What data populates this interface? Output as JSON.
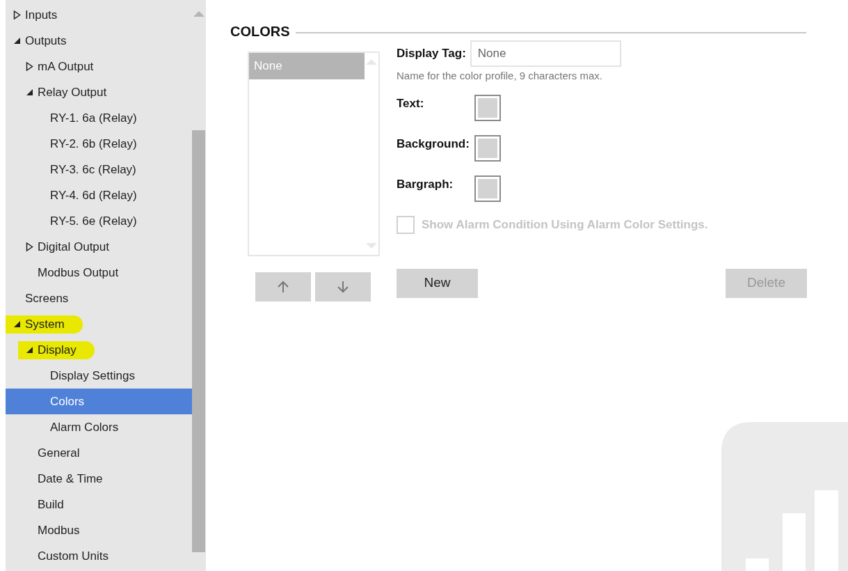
{
  "tree": [
    {
      "label": "Inputs",
      "expanded": false,
      "selected": false,
      "highlighted": false
    },
    {
      "label": "Outputs",
      "expanded": true,
      "selected": false,
      "highlighted": false,
      "children": [
        {
          "label": "mA Output",
          "expanded": false,
          "selected": false,
          "highlighted": false
        },
        {
          "label": "Relay Output",
          "expanded": true,
          "selected": false,
          "highlighted": false,
          "children": [
            {
              "label": "RY-1. 6a (Relay)",
              "selected": false,
              "highlighted": false
            },
            {
              "label": "RY-2. 6b (Relay)",
              "selected": false,
              "highlighted": false
            },
            {
              "label": "RY-3. 6c (Relay)",
              "selected": false,
              "highlighted": false
            },
            {
              "label": "RY-4. 6d (Relay)",
              "selected": false,
              "highlighted": false
            },
            {
              "label": "RY-5. 6e (Relay)",
              "selected": false,
              "highlighted": false
            }
          ]
        },
        {
          "label": "Digital Output",
          "expanded": false,
          "selected": false,
          "highlighted": false
        },
        {
          "label": "Modbus Output",
          "selected": false,
          "highlighted": false
        }
      ]
    },
    {
      "label": "Screens",
      "selected": false,
      "highlighted": false
    },
    {
      "label": "System",
      "expanded": true,
      "selected": false,
      "highlighted": true,
      "children": [
        {
          "label": "Display",
          "expanded": true,
          "selected": false,
          "highlighted": true,
          "children": [
            {
              "label": "Display Settings",
              "selected": false,
              "highlighted": false
            },
            {
              "label": "Colors",
              "selected": true,
              "highlighted": false
            },
            {
              "label": "Alarm Colors",
              "selected": false,
              "highlighted": false
            }
          ]
        },
        {
          "label": "General",
          "selected": false,
          "highlighted": false
        },
        {
          "label": "Date & Time",
          "selected": false,
          "highlighted": false
        },
        {
          "label": "Build",
          "selected": false,
          "highlighted": false
        },
        {
          "label": "Modbus",
          "selected": false,
          "highlighted": false
        },
        {
          "label": "Custom Units",
          "selected": false,
          "highlighted": false
        }
      ]
    }
  ],
  "section_title": "COLORS",
  "profile_list": [
    {
      "label": "None",
      "selected": true
    }
  ],
  "display_tag": {
    "label": "Display Tag:",
    "value": "None",
    "hint": "Name for the color profile, 9 characters max."
  },
  "swatches": [
    {
      "label": "Text:",
      "color": "#d3d3d3"
    },
    {
      "label": "Background:",
      "color": "#d3d3d3"
    },
    {
      "label": "Bargraph:",
      "color": "#d3d3d3"
    }
  ],
  "alarm_checkbox": {
    "label": "Show Alarm Condition Using Alarm Color Settings.",
    "checked": false,
    "disabled": true
  },
  "buttons": {
    "new": {
      "label": "New",
      "disabled": false
    },
    "delete": {
      "label": "Delete",
      "disabled": true
    }
  }
}
